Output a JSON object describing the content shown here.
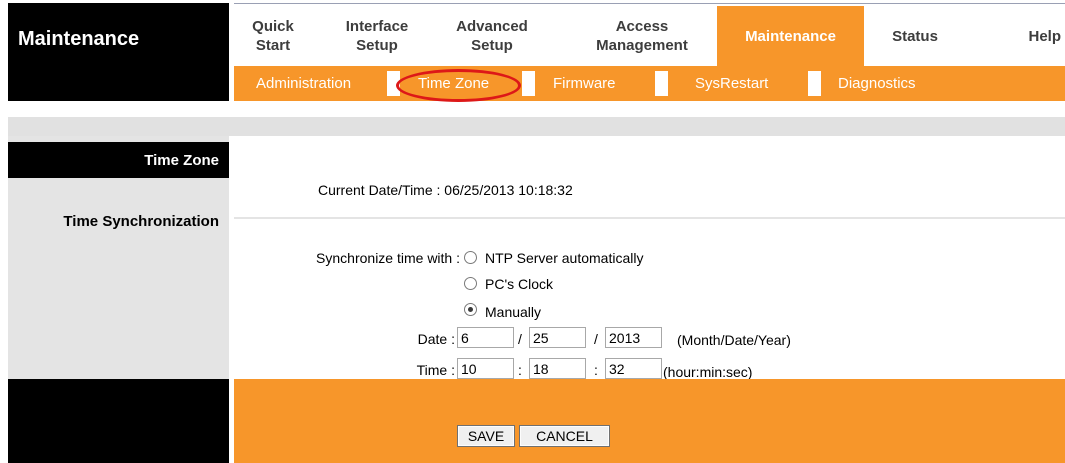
{
  "header": {
    "brand": "Maintenance",
    "main_tabs": [
      {
        "label_line1": "Quick",
        "label_line2": "Start"
      },
      {
        "label_line1": "Interface",
        "label_line2": "Setup"
      },
      {
        "label_line1": "Advanced",
        "label_line2": "Setup"
      },
      {
        "label_line1": "Access",
        "label_line2": "Management"
      },
      {
        "label": "Maintenance",
        "active": true
      },
      {
        "label": "Status"
      },
      {
        "label": "Help"
      }
    ],
    "sub_tabs": [
      {
        "label": "Administration"
      },
      {
        "label": "Time Zone",
        "active": true
      },
      {
        "label": "Firmware"
      },
      {
        "label": "SysRestart"
      },
      {
        "label": "Diagnostics"
      }
    ]
  },
  "sidebar": {
    "time_zone": "Time Zone",
    "time_sync": "Time Synchronization"
  },
  "content": {
    "current_datetime_label": "Current Date/Time :",
    "current_datetime_value": "06/25/2013 10:18:32",
    "sync_label": "Synchronize time with :",
    "sync_options": [
      {
        "label": "NTP Server automatically",
        "checked": false
      },
      {
        "label": "PC's Clock",
        "checked": false
      },
      {
        "label": "Manually",
        "checked": true
      }
    ],
    "date": {
      "label": "Date :",
      "month": "6",
      "day": "25",
      "year": "2013",
      "sep": "/",
      "format_hint": "(Month/Date/Year)"
    },
    "time": {
      "label": "Time :",
      "hour": "10",
      "minute": "18",
      "second": "32",
      "sep": ":",
      "format_hint": "(hour:min:sec)"
    }
  },
  "footer": {
    "save_label": "SAVE",
    "cancel_label": "CANCEL"
  },
  "colors": {
    "accent_orange": "#f7962a",
    "highlight_oval": "#dd1818",
    "black": "#000000",
    "panel_gray": "#e4e4e4"
  }
}
